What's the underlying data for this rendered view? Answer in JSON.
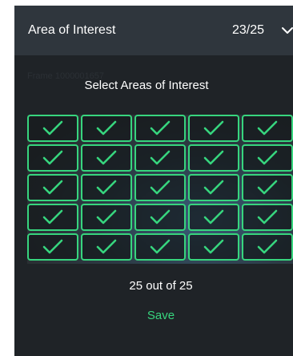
{
  "header": {
    "title": "Area of Interest",
    "counter": "23/25",
    "chevron_icon": "chevron-down-icon"
  },
  "content": {
    "frame_label": "Frame 1000001657",
    "subtitle": "Select Areas of Interest",
    "grid": {
      "rows": 5,
      "columns": 5,
      "selected": 25,
      "check_icon": "check-icon"
    },
    "count_text": "25 out of 25",
    "save_label": "Save"
  },
  "colors": {
    "accent_green": "#37d57e",
    "header_bg": "#2f363d",
    "panel_bg": "#1f2327"
  }
}
